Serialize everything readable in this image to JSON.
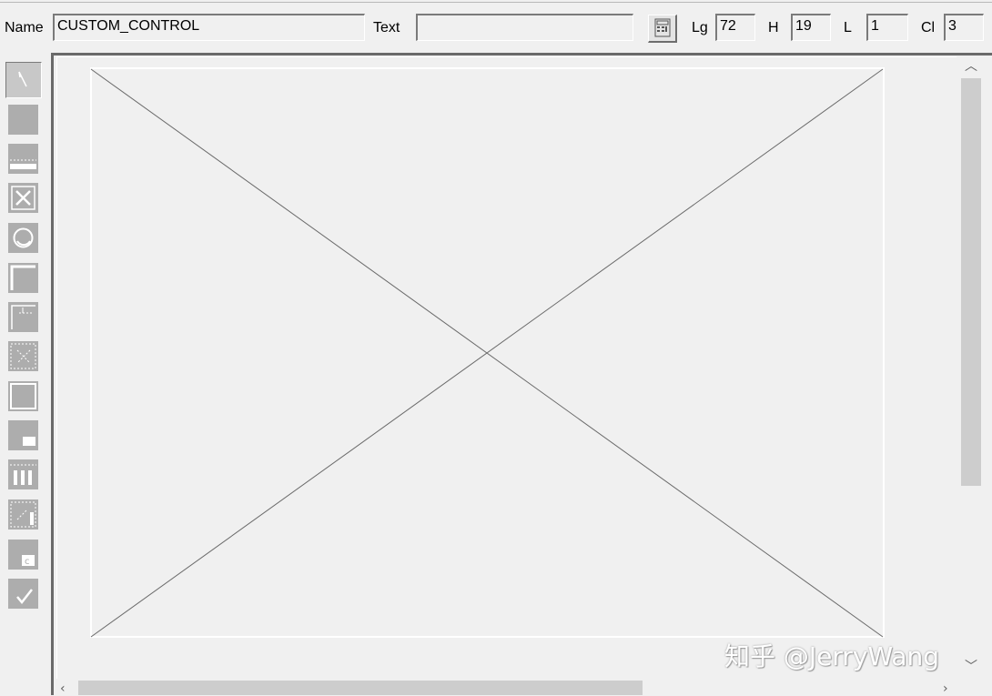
{
  "attributes": {
    "name_label": "Name",
    "name_value": "CUSTOM_CONTROL",
    "text_label": "Text",
    "text_value": "",
    "lg_label": "Lg",
    "lg_value": "72",
    "h_label": "H",
    "h_value": "19",
    "l_label": "L",
    "l_value": "1",
    "cl_label": "Cl",
    "cl_value": "3"
  },
  "palette": {
    "tools": [
      {
        "icon": "pointer-icon",
        "selected": true
      },
      {
        "icon": "text-field-icon"
      },
      {
        "icon": "input-field-icon"
      },
      {
        "icon": "checkbox-icon"
      },
      {
        "icon": "radio-button-icon"
      },
      {
        "icon": "box-icon"
      },
      {
        "icon": "subscreen-icon"
      },
      {
        "icon": "table-control-icon"
      },
      {
        "icon": "frame-icon"
      },
      {
        "icon": "tabstrip-icon"
      },
      {
        "icon": "table-columns-icon"
      },
      {
        "icon": "table-wizard-icon"
      },
      {
        "icon": "custom-control-icon"
      },
      {
        "icon": "status-icon"
      }
    ]
  },
  "watermark": {
    "text": "知乎 @JerryWang"
  },
  "colors": {
    "background": "#f0f0f0",
    "tool": "#adadad",
    "scroll_thumb": "#cdcdcd",
    "lines": "#6a6a6a"
  }
}
